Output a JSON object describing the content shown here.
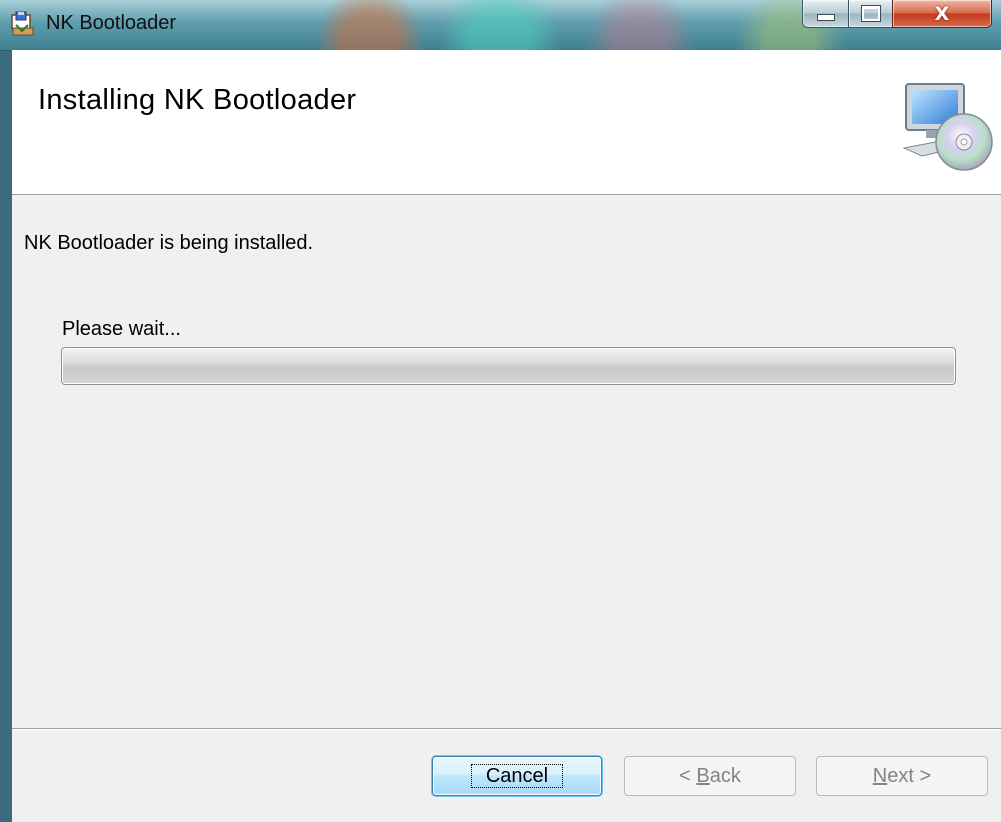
{
  "window": {
    "title": "NK Bootloader",
    "controls": {
      "minimize": "minimize",
      "maximize": "maximize",
      "close": "X"
    }
  },
  "header": {
    "title": "Installing NK Bootloader",
    "icon": "computer-cd-icon"
  },
  "body": {
    "status_text": "NK Bootloader is being installed.",
    "wait_label": "Please wait...",
    "progress": 0.0
  },
  "buttons": {
    "cancel_label": "Cancel",
    "back": {
      "prefix": "< ",
      "mnemonic": "B",
      "rest": "ack"
    },
    "next": {
      "mnemonic": "N",
      "rest": "ext",
      "suffix": " >"
    }
  },
  "colors": {
    "dialog_bg": "#f0f0f0",
    "header_bg": "#ffffff",
    "default_button_border": "#3c7fb1",
    "disabled_text": "#838383"
  }
}
